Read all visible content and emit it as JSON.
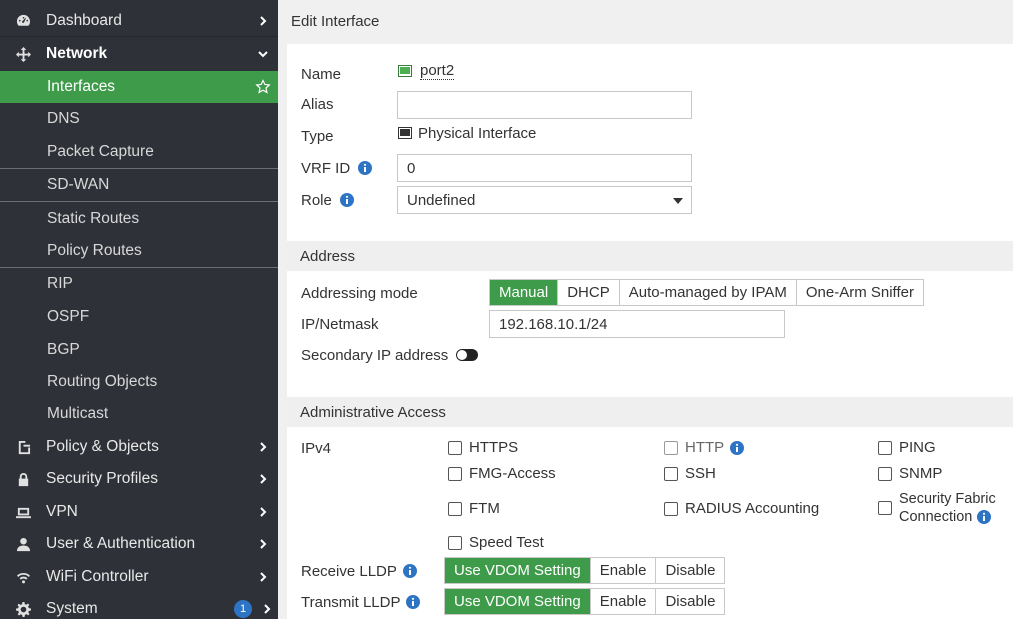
{
  "sidebar": {
    "dashboard": "Dashboard",
    "network": "Network",
    "items": [
      "Interfaces",
      "DNS",
      "Packet Capture",
      "SD-WAN",
      "Static Routes",
      "Policy Routes",
      "RIP",
      "OSPF",
      "BGP",
      "Routing Objects",
      "Multicast"
    ],
    "policy_objects": "Policy & Objects",
    "security_profiles": "Security Profiles",
    "vpn": "VPN",
    "user_auth": "User & Authentication",
    "wifi": "WiFi Controller",
    "system": "System",
    "system_badge": "1"
  },
  "page": {
    "title": "Edit Interface"
  },
  "form": {
    "name_label": "Name",
    "name_value": "port2",
    "alias_label": "Alias",
    "alias_value": "",
    "type_label": "Type",
    "type_value": "Physical Interface",
    "vrf_label": "VRF ID",
    "vrf_value": "0",
    "role_label": "Role",
    "role_value": "Undefined"
  },
  "address": {
    "section": "Address",
    "mode_label": "Addressing mode",
    "modes": [
      "Manual",
      "DHCP",
      "Auto-managed by IPAM",
      "One-Arm Sniffer"
    ],
    "selected_mode": "Manual",
    "ip_label": "IP/Netmask",
    "ip_value": "192.168.10.1/24",
    "secondary_label": "Secondary IP address"
  },
  "admin": {
    "section": "Administrative Access",
    "ipv4_label": "IPv4",
    "https": "HTTPS",
    "http": "HTTP",
    "ping": "PING",
    "fmg": "FMG-Access",
    "ssh": "SSH",
    "snmp": "SNMP",
    "ftm": "FTM",
    "radius": "RADIUS Accounting",
    "fabric_line1": "Security Fabric",
    "fabric_line2": "Connection",
    "speed": "Speed Test"
  },
  "lldp": {
    "receive_label": "Receive LLDP",
    "transmit_label": "Transmit LLDP",
    "options": [
      "Use VDOM Setting",
      "Enable",
      "Disable"
    ]
  },
  "colors": {
    "accent_green": "#3e9b4a",
    "sidebar_bg": "#2f3138",
    "info_blue": "#2e74c4"
  }
}
